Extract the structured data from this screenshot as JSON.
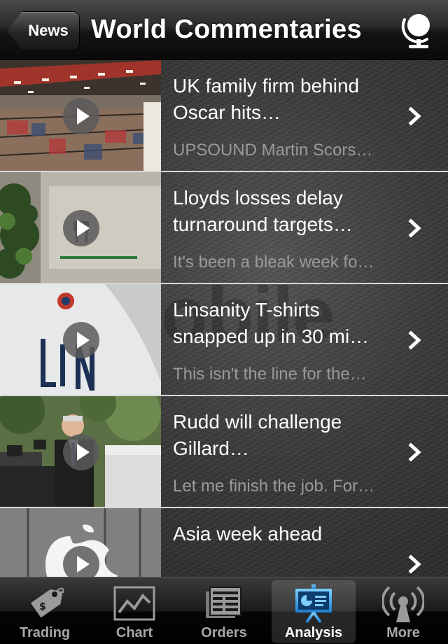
{
  "nav": {
    "back_label": "News",
    "title": "World Commentaries"
  },
  "background_watermark": "obile",
  "articles": [
    {
      "headline": "UK family firm behind Oscar hits…",
      "summary": "UPSOUND Martin Scors…"
    },
    {
      "headline": "Lloyds losses delay turnaround targets…",
      "summary": "It's been a bleak week fo…"
    },
    {
      "headline": "Linsanity T-shirts snapped up in 30 mi…",
      "summary": "This isn't the line for the…"
    },
    {
      "headline": "Rudd will challenge Gillard…",
      "summary": "Let me finish the job. For…"
    },
    {
      "headline": "Asia week ahead",
      "summary": ""
    }
  ],
  "tabs": [
    {
      "label": "Trading",
      "icon": "price-tag-icon",
      "selected": false
    },
    {
      "label": "Chart",
      "icon": "line-chart-icon",
      "selected": false
    },
    {
      "label": "Orders",
      "icon": "orders-icon",
      "selected": false
    },
    {
      "label": "Analysis",
      "icon": "presentation-board-icon",
      "selected": true
    },
    {
      "label": "More",
      "icon": "broadcast-icon",
      "selected": false
    }
  ],
  "colors": {
    "selected_tab_accent": "#3a9ee8",
    "headline_text": "#ffffff",
    "summary_text": "#9a9a9a"
  }
}
